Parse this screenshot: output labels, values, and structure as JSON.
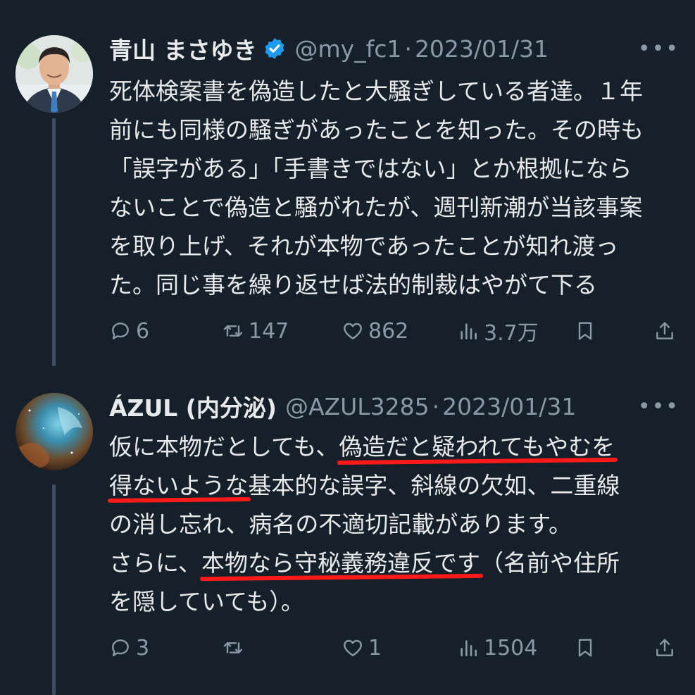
{
  "tweets": [
    {
      "author": {
        "name": "青山 まさゆき",
        "verified": true,
        "handle": "@my_fc1",
        "date": "2023/01/31",
        "avatar": "avatar-photo-man-in-suit"
      },
      "more_label": "•••",
      "text_lines": [
        "死体検案書を偽造したと大騒ぎしている者達。１年",
        "前にも同様の騒ぎがあったことを知った。その時も",
        "「誤字がある」「手書きではない」とか根拠になら",
        "ないことで偽造と騒がれたが、週刊新潮が当該事案",
        "を取り上げ、それが本物であったことが知れ渡っ",
        "た。同じ事を繰り返せば法的制裁はやがて下る"
      ],
      "stats": {
        "replies": "6",
        "retweets": "147",
        "likes": "862",
        "views": "3.7万"
      }
    },
    {
      "author": {
        "name": "ÁZUL (内分泌)",
        "handle": "@AZUL3285",
        "date": "2023/01/31",
        "avatar": "avatar-nebula-image"
      },
      "more_label": "•••",
      "text_lines": [
        {
          "before": "仮に本物だとしても、",
          "hl": "偽造だと疑われてもやむを",
          "after": ""
        },
        {
          "before": "",
          "hl": "得ないような",
          "after": "基本的な誤字、斜線の欠如、二重線"
        },
        {
          "before": "の消し忘れ、病名の不適切記載があります。",
          "hl": "",
          "after": ""
        },
        {
          "before": "さらに、",
          "hl": "本物なら守秘義務違反です",
          "after": "（名前や住所"
        },
        {
          "before": "を隠していても）。",
          "hl": "",
          "after": ""
        }
      ],
      "stats": {
        "replies": "3",
        "retweets": "",
        "likes": "1",
        "views": "1504"
      }
    }
  ],
  "colors": {
    "background": "#15202b",
    "text": "#e7e9ea",
    "muted": "#8b98a5",
    "verified": "#1d9bf0",
    "annotation": "#ff1a1a"
  },
  "icons": [
    "reply-icon",
    "retweet-icon",
    "like-icon",
    "views-icon",
    "bookmark-icon",
    "share-icon",
    "verified-badge-icon",
    "more-icon"
  ]
}
